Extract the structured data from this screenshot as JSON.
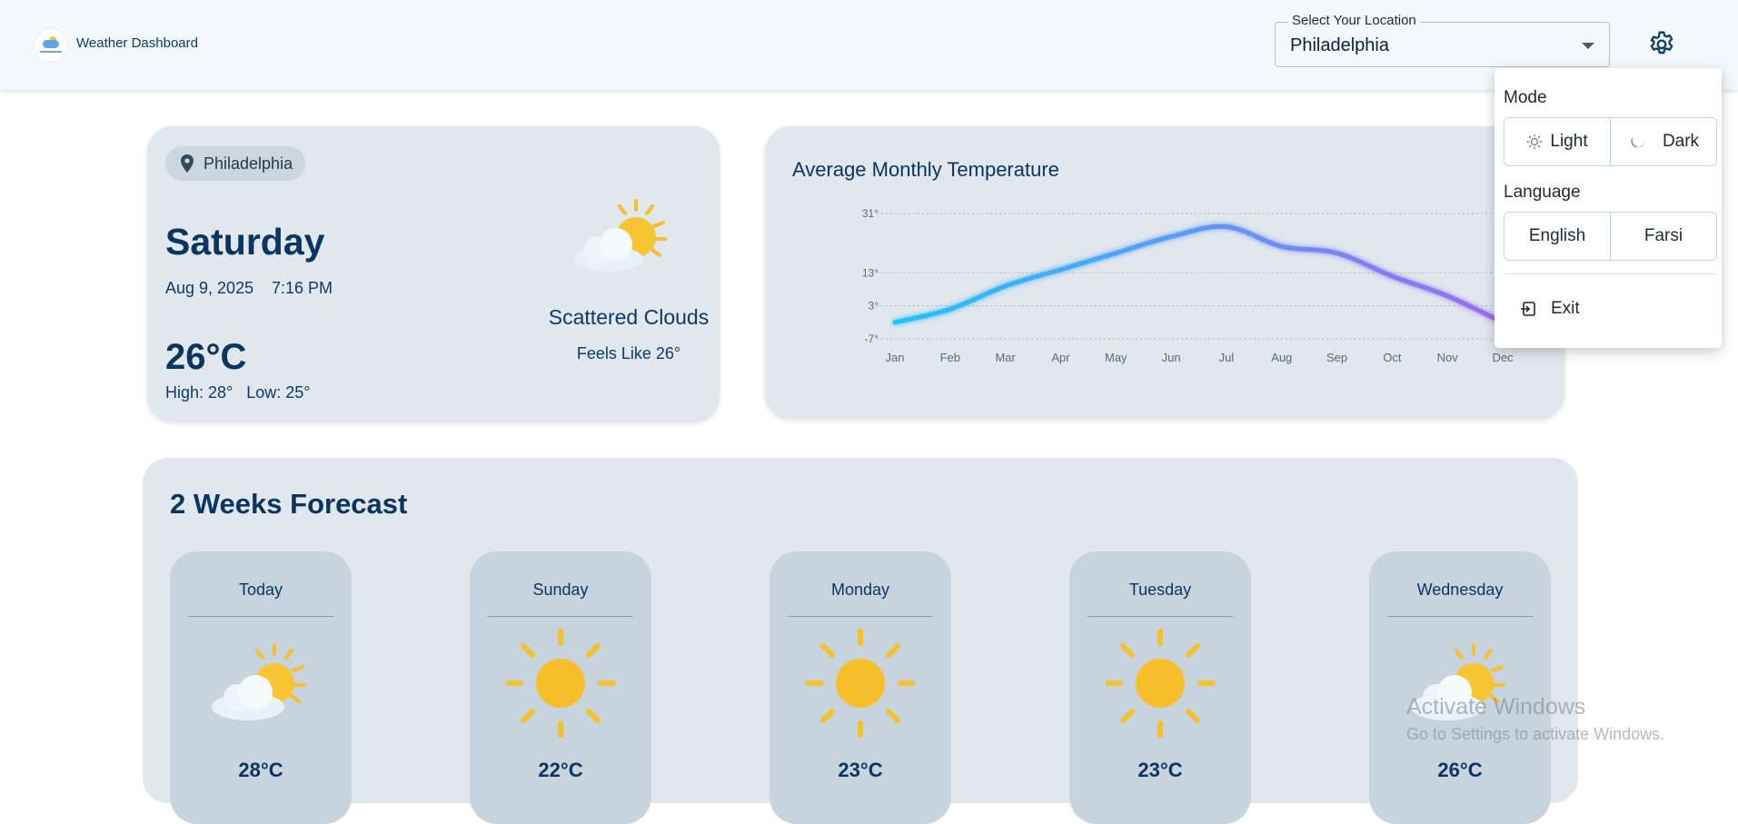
{
  "header": {
    "app_title": "Weather Dashboard",
    "location_label": "Select Your Location",
    "location_value": "Philadelphia"
  },
  "current": {
    "location": "Philadelphia",
    "day": "Saturday",
    "date": "Aug 9, 2025",
    "time": "7:16 PM",
    "temperature": "26°C",
    "high_low": "High: 28°   Low: 25°",
    "condition": "Scattered Clouds",
    "feels_like": "Feels Like 26°",
    "icon": "partly-cloudy-icon"
  },
  "chart": {
    "title": "Average Monthly Temperature"
  },
  "chart_data": {
    "type": "line",
    "title": "Average Monthly Temperature",
    "x": [
      "Jan",
      "Feb",
      "Mar",
      "Apr",
      "May",
      "Jun",
      "Jul",
      "Aug",
      "Sep",
      "Oct",
      "Nov",
      "Dec"
    ],
    "yticks": [
      "31°",
      "13°",
      "3°",
      "-7°"
    ],
    "ytick_values": [
      31,
      13,
      3,
      -7
    ],
    "ylim": [
      -7,
      31
    ],
    "series": [
      {
        "values": [
          -2,
          2,
          9,
          14,
          19,
          24,
          27,
          21,
          19,
          12,
          6,
          -2
        ]
      }
    ],
    "grid": true,
    "line_gradient": [
      "#22c3f5",
      "#9a6cf0"
    ]
  },
  "forecast": {
    "title": "2 Weeks Forecast",
    "days": [
      {
        "name": "Today",
        "temp": "28°C",
        "icon": "partly-cloudy-icon"
      },
      {
        "name": "Sunday",
        "temp": "22°C",
        "icon": "sun-icon"
      },
      {
        "name": "Monday",
        "temp": "23°C",
        "icon": "sun-icon"
      },
      {
        "name": "Tuesday",
        "temp": "23°C",
        "icon": "sun-icon"
      },
      {
        "name": "Wednesday",
        "temp": "26°C",
        "icon": "partly-cloudy-icon"
      }
    ]
  },
  "settings": {
    "mode_label": "Mode",
    "light": "Light",
    "dark": "Dark",
    "language_label": "Language",
    "english": "English",
    "farsi": "Farsi",
    "exit": "Exit"
  },
  "watermark": {
    "line1": "Activate Windows",
    "line2": "Go to Settings to activate Windows."
  }
}
